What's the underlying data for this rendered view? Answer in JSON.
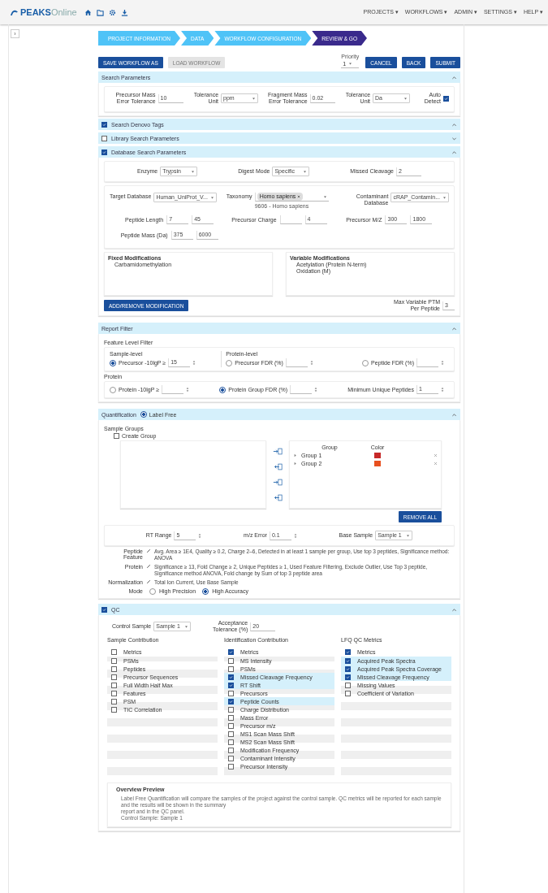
{
  "app": {
    "logo_bold": "PEAKS",
    "logo_light": "Online",
    "menu": [
      "PROJECTS ▾",
      "WORKFLOWS ▾",
      "ADMIN ▾",
      "SETTINGS ▾",
      "HELP ▾"
    ]
  },
  "sidebar_toggle": "›",
  "steps": [
    {
      "label": "PROJECT INFORMATION",
      "selected": false
    },
    {
      "label": "DATA",
      "selected": false
    },
    {
      "label": "WORKFLOW CONFIGURATION",
      "selected": false
    },
    {
      "label": "REVIEW & GO",
      "selected": true
    }
  ],
  "toolbar": {
    "save": "SAVE WORKFLOW AS",
    "load": {
      "label": "LOAD WORKFLOW",
      "disabled": true
    },
    "priority": {
      "label": "Priority",
      "value": "1"
    },
    "buttons": [
      "CANCEL",
      "BACK",
      "SUBMIT"
    ]
  },
  "search_params": {
    "title": "Search Parameters",
    "expanded": true,
    "fields": [
      {
        "kind": "input",
        "label": "Precursor Mass Error Tolerance",
        "value": "10"
      },
      {
        "kind": "select",
        "label": "Tolerance Unit",
        "value": "ppm"
      },
      {
        "kind": "input",
        "label": "Fragment Mass Error Tolerance",
        "value": "0.02"
      },
      {
        "kind": "select",
        "label": "Tolerance Unit",
        "value": "Da"
      },
      {
        "kind": "checkbox",
        "label": "Auto Detect",
        "checked": true
      }
    ]
  },
  "toggle_sections": [
    {
      "title": "Search Denovo Tags",
      "checked": true,
      "expanded": true
    },
    {
      "title": "Library Search Parameters",
      "checked": false,
      "expanded": false
    }
  ],
  "db_search": {
    "title": "Database Search Parameters",
    "checked": true,
    "expanded": true,
    "row1": [
      {
        "kind": "select",
        "label": "Enzyme",
        "value": "Trypsin"
      },
      {
        "kind": "select",
        "label": "Digest Mode",
        "value": "Specific"
      },
      {
        "kind": "input",
        "label": "Missed Cleavage",
        "value": "2"
      }
    ],
    "row2": [
      {
        "kind": "select",
        "label": "Target Database",
        "value": "Human_UniProt_V..."
      },
      {
        "kind": "chips",
        "label": "Taxonomy",
        "value": "Homo sapiens",
        "hint": "9606 - Homo sapiens"
      },
      {
        "kind": "select",
        "label": "Contaminant Database",
        "value": "cRAP_Contamin..."
      }
    ],
    "ranges": [
      {
        "label": "Peptide Length",
        "from": "7",
        "to": "45"
      },
      {
        "label": "Precursor Charge",
        "to": "4"
      },
      {
        "label": "Precursor M/Z",
        "from": "300",
        "to": "1800"
      },
      {
        "label": "Peptide Mass (Da)",
        "from": "375",
        "to": "6000"
      }
    ],
    "mods": [
      {
        "title": "Fixed Modifications",
        "items": [
          "Carbamidomethylation"
        ]
      },
      {
        "title": "Variable Modifications",
        "items": [
          "Acetylation (Protein N-term)",
          "Oxidation (M)"
        ]
      }
    ],
    "mod_button": "ADD/REMOVE MODIFICATION",
    "max_ptm": {
      "label": "Max Variable PTM Per Peptide",
      "value": "3"
    }
  },
  "report_filter": {
    "title": "Report Filter",
    "expanded": true,
    "subtitle": "Feature Level Filter",
    "groups": [
      {
        "panels": [
          {
            "title": "Sample-level",
            "options": [
              {
                "kind": "radio",
                "label": "Precursor -10lgP ≥",
                "value": "15",
                "selected": true
              }
            ]
          },
          {
            "title": "Protein-level",
            "options": [
              {
                "kind": "radio",
                "label": "Precursor FDR (%)",
                "selected": false
              },
              {
                "kind": "radio",
                "label": "Peptide FDR (%)",
                "selected": false
              }
            ]
          }
        ]
      },
      {
        "title": "Protein",
        "panels": [
          {
            "options": [
              {
                "kind": "radio",
                "label": "Protein -10lgP ≥",
                "selected": false
              },
              {
                "kind": "radio",
                "label": "Protein Group FDR (%)",
                "selected": true
              },
              {
                "kind": "plain",
                "label": "Minimum Unique Peptides",
                "value": "1"
              }
            ]
          }
        ]
      }
    ]
  },
  "quant": {
    "title": "Quantification",
    "mode": {
      "label": "Label Free",
      "selected": true
    },
    "expanded": true,
    "groups_label": "Sample Groups",
    "create": {
      "label": "Create Group",
      "checked": false
    },
    "columns": [
      "Group",
      "Color"
    ],
    "groups": [
      {
        "name": "Group 1",
        "color": "#c62828"
      },
      {
        "name": "Group 2",
        "color": "#e8501f"
      }
    ],
    "remove_all": "REMOVE ALL",
    "params": [
      {
        "kind": "spin",
        "label": "RT Range",
        "value": "5"
      },
      {
        "kind": "spin",
        "label": "m/z Error",
        "value": "0.1"
      },
      {
        "kind": "select",
        "label": "Base Sample",
        "value": "Sample 1"
      }
    ],
    "summary": [
      {
        "label": "Peptide Feature",
        "text": "Avg. Area ≥ 1E4, Quality ≥ 0.2, Charge 2–6, Detected in at least 1 sample per group, Use top 3 peptides, Significance method: ANOVA"
      },
      {
        "label": "Protein",
        "text": "Significance ≥ 13, Fold Change ≥ 2, Unique Peptides ≥ 1, Used Feature Filtering, Exclude Outlier, Use Top 3 peptide, Significance method ANOVA, Fold change by Sum of top 3 peptide area"
      },
      {
        "label": "Normalization",
        "text": "Total Ion Current, Use Base Sample"
      }
    ],
    "modes_label": "Mode",
    "modes": [
      {
        "label": "High Precision",
        "selected": false
      },
      {
        "label": "High Accuracy",
        "selected": true
      }
    ]
  },
  "qc": {
    "title": "QC",
    "checked": true,
    "expanded": true,
    "control": {
      "label": "Control Sample",
      "value": "Sample 1"
    },
    "tolerance": {
      "label": "Acceptance Tolerance (%)",
      "value": "20"
    },
    "lists": [
      {
        "title": "Sample Contribution",
        "column": "Metrics",
        "checked": false,
        "items": [
          {
            "label": "PSMs",
            "checked": false
          },
          {
            "label": "Peptides",
            "checked": false
          },
          {
            "label": "Precursor Sequences",
            "checked": false
          },
          {
            "label": "Full Width Half Max",
            "checked": false
          },
          {
            "label": "Features",
            "checked": false
          },
          {
            "label": "PSM",
            "checked": false
          },
          {
            "label": "TIC Correlation",
            "checked": false
          }
        ]
      },
      {
        "title": "Identification Contribution",
        "column": "Metrics",
        "checked": true,
        "items": [
          {
            "label": "MS Intensity",
            "checked": false
          },
          {
            "label": "PSMs",
            "checked": false
          },
          {
            "label": "Missed Cleavage Frequency",
            "checked": true
          },
          {
            "label": "RT Shift",
            "checked": true
          },
          {
            "label": "Precursors",
            "checked": false
          },
          {
            "label": "Peptide Counts",
            "checked": true
          },
          {
            "label": "Charge Distribution",
            "checked": false
          },
          {
            "label": "Mass Error",
            "checked": false
          },
          {
            "label": "Precursor m/z",
            "checked": false
          },
          {
            "label": "MS1 Scan Mass Shift",
            "checked": false
          },
          {
            "label": "MS2 Scan Mass Shift",
            "checked": false
          },
          {
            "label": "Modification Frequency",
            "checked": false
          },
          {
            "label": "Contaminant Intensity",
            "checked": false
          },
          {
            "label": "Precursor Intensity",
            "checked": false
          }
        ]
      },
      {
        "title": "LFQ QC Metrics",
        "column": "Metrics",
        "checked": true,
        "items": [
          {
            "label": "Acquired Peak Spectra",
            "checked": true
          },
          {
            "label": "Acquired Peak Spectra Coverage",
            "checked": true
          },
          {
            "label": "Missed Cleavage Frequency",
            "checked": true
          },
          {
            "label": "Missing Values",
            "checked": false
          },
          {
            "label": "Coefficient of Variation",
            "checked": false
          }
        ]
      }
    ],
    "preview_title": "Overview Preview",
    "preview_lines": [
      "Label Free Quantification will compare the samples of the project against the control sample. QC metrics will be reported for each sample and the results will be shown in the summary",
      "report and in the QC panel.",
      "Control Sample: Sample 1"
    ]
  }
}
